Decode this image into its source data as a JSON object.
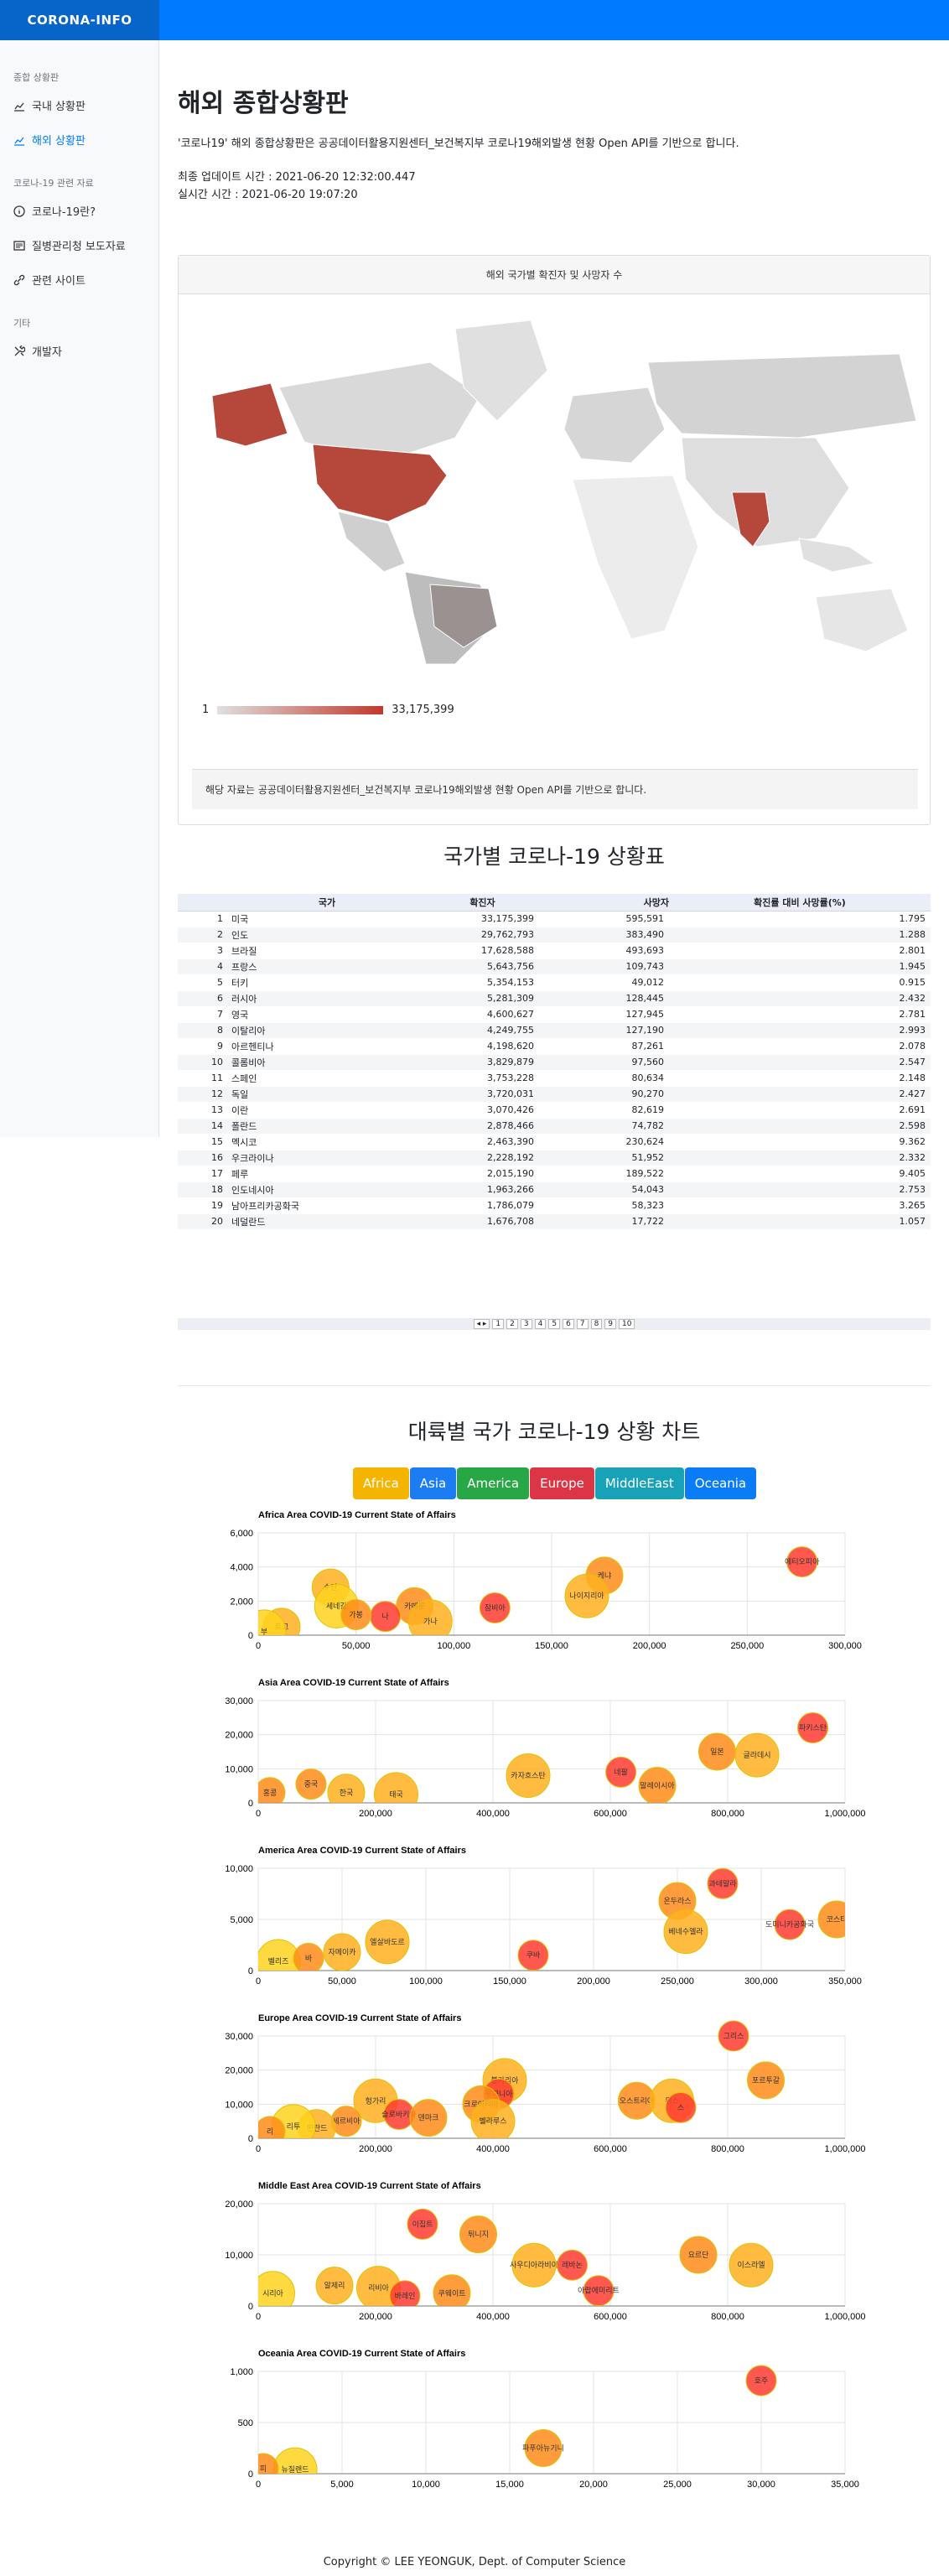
{
  "brand": "CORONA-INFO",
  "sidebar": {
    "sections": [
      {
        "heading": "종합 상황판",
        "items": [
          {
            "label": "국내 상황판",
            "icon": "chart-line-icon",
            "active": false
          },
          {
            "label": "해외 상황판",
            "icon": "chart-line-icon",
            "active": true
          }
        ]
      },
      {
        "heading": "코로나-19 관련 자료",
        "items": [
          {
            "label": "코로나-19란?",
            "icon": "info-circle-icon",
            "active": false
          },
          {
            "label": "질병관리청 보도자료",
            "icon": "newspaper-icon",
            "active": false
          },
          {
            "label": "관련 사이트",
            "icon": "link-icon",
            "active": false
          }
        ]
      },
      {
        "heading": "기타",
        "items": [
          {
            "label": "개발자",
            "icon": "tools-icon",
            "active": false
          }
        ]
      }
    ]
  },
  "page": {
    "title": "해외 종합상황판",
    "description": "'코로나19' 해외 종합상황판은 공공데이터활용지원센터_보건복지부 코로나19해외발생 현황 Open API를 기반으로 합니다.",
    "updated": "최종 업데이트 시간 : 2021-06-20 12:32:00.447",
    "realtime": "실시간 시간 : 2021-06-20 19:07:20"
  },
  "map": {
    "header": "해외 국가별 확진자 및 사망자 수",
    "legend_min": "1",
    "legend_max": "33,175,399",
    "footer": "해당 자료는 공공데이터활용지원센터_보건복지부 코로나19해외발생 현황 Open API를 기반으로 합니다."
  },
  "table": {
    "title": "국가별 코로나-19 상황표",
    "headers": [
      "",
      "국가",
      "확진자",
      "사망자",
      "확진률 대비 사망률(%)"
    ],
    "rows": [
      [
        "1",
        "미국",
        "33,175,399",
        "595,591",
        "1.795"
      ],
      [
        "2",
        "인도",
        "29,762,793",
        "383,490",
        "1.288"
      ],
      [
        "3",
        "브라질",
        "17,628,588",
        "493,693",
        "2.801"
      ],
      [
        "4",
        "프랑스",
        "5,643,756",
        "109,743",
        "1.945"
      ],
      [
        "5",
        "터키",
        "5,354,153",
        "49,012",
        "0.915"
      ],
      [
        "6",
        "러시아",
        "5,281,309",
        "128,445",
        "2.432"
      ],
      [
        "7",
        "영국",
        "4,600,627",
        "127,945",
        "2.781"
      ],
      [
        "8",
        "이탈리아",
        "4,249,755",
        "127,190",
        "2.993"
      ],
      [
        "9",
        "아르헨티나",
        "4,198,620",
        "87,261",
        "2.078"
      ],
      [
        "10",
        "콜롬비아",
        "3,829,879",
        "97,560",
        "2.547"
      ],
      [
        "11",
        "스페인",
        "3,753,228",
        "80,634",
        "2.148"
      ],
      [
        "12",
        "독일",
        "3,720,031",
        "90,270",
        "2.427"
      ],
      [
        "13",
        "이란",
        "3,070,426",
        "82,619",
        "2.691"
      ],
      [
        "14",
        "폴란드",
        "2,878,466",
        "74,782",
        "2.598"
      ],
      [
        "15",
        "멕시코",
        "2,463,390",
        "230,624",
        "9.362"
      ],
      [
        "16",
        "우크라이나",
        "2,228,192",
        "51,952",
        "2.332"
      ],
      [
        "17",
        "페루",
        "2,015,190",
        "189,522",
        "9.405"
      ],
      [
        "18",
        "인도네시아",
        "1,963,266",
        "54,043",
        "2.753"
      ],
      [
        "19",
        "남아프리카공화국",
        "1,786,079",
        "58,323",
        "3.265"
      ],
      [
        "20",
        "네덜란드",
        "1,676,708",
        "17,722",
        "1.057"
      ]
    ],
    "pages": [
      "1",
      "2",
      "3",
      "4",
      "5",
      "6",
      "7",
      "8",
      "9",
      "10"
    ]
  },
  "continent": {
    "title": "대륙별 국가 코로나-19 상황 차트",
    "tabs": [
      {
        "label": "Africa",
        "color": "#f5b400"
      },
      {
        "label": "Asia",
        "color": "#1c7cf2"
      },
      {
        "label": "America",
        "color": "#27a745"
      },
      {
        "label": "Europe",
        "color": "#dc3545"
      },
      {
        "label": "MiddleEast",
        "color": "#17a2b8"
      },
      {
        "label": "Oceania",
        "color": "#0a7cf5"
      }
    ]
  },
  "chart_data": [
    {
      "type": "scatter",
      "title": "Africa Area COVID-19 Current State of Affairs",
      "xlim": [
        0,
        300000
      ],
      "ylim": [
        0,
        6000
      ],
      "xticks": [
        "0",
        "50,000",
        "100,000",
        "150,000",
        "200,000",
        "250,000",
        "300,000"
      ],
      "yticks": [
        "0",
        "2,000",
        "4,000",
        "6,000"
      ],
      "points": [
        [
          278000,
          4300,
          "에티오피아"
        ],
        [
          177000,
          3500,
          "케냐"
        ],
        [
          168000,
          2300,
          "나이지리아"
        ],
        [
          121000,
          1600,
          "잠비아"
        ],
        [
          80000,
          1700,
          "카메룬"
        ],
        [
          88000,
          800,
          "가나"
        ],
        [
          65000,
          1100,
          "나"
        ],
        [
          37000,
          2800,
          "수단"
        ],
        [
          40000,
          1700,
          "세네갈"
        ],
        [
          50000,
          1200,
          "가봉"
        ],
        [
          12000,
          500,
          "토고"
        ],
        [
          3000,
          200,
          "부"
        ]
      ]
    },
    {
      "type": "scatter",
      "title": "Asia Area COVID-19 Current State of Affairs",
      "xlim": [
        0,
        1000000
      ],
      "ylim": [
        0,
        30000
      ],
      "xticks": [
        "0",
        "200,000",
        "400,000",
        "600,000",
        "800,000",
        "1,000,000"
      ],
      "yticks": [
        "0",
        "10,000",
        "20,000",
        "30,000"
      ],
      "points": [
        [
          945000,
          22000,
          "파키스탄"
        ],
        [
          782000,
          15000,
          "일본"
        ],
        [
          850000,
          14000,
          "글라데시"
        ],
        [
          618000,
          9000,
          "네팔"
        ],
        [
          680000,
          5000,
          "말레이시아"
        ],
        [
          460000,
          8000,
          "카자흐스탄"
        ],
        [
          90000,
          5500,
          "중국"
        ],
        [
          150000,
          3000,
          "한국"
        ],
        [
          235000,
          2500,
          "태국"
        ],
        [
          20000,
          3000,
          "홍콩"
        ]
      ]
    },
    {
      "type": "scatter",
      "title": "America Area COVID-19 Current State of Affairs",
      "xlim": [
        0,
        350000
      ],
      "ylim": [
        0,
        10000
      ],
      "xticks": [
        "0",
        "50,000",
        "100,000",
        "150,000",
        "200,000",
        "250,000",
        "300,000",
        "350,000"
      ],
      "yticks": [
        "0",
        "5,000",
        "10,000"
      ],
      "points": [
        [
          277000,
          8500,
          "과테말라"
        ],
        [
          250000,
          6800,
          "온두라스"
        ],
        [
          255000,
          3800,
          "베네수엘라"
        ],
        [
          317000,
          4500,
          "도미니카공화국"
        ],
        [
          345000,
          5000,
          "코스타"
        ],
        [
          77000,
          2800,
          "엘살바도르"
        ],
        [
          164000,
          1500,
          "쿠바"
        ],
        [
          50000,
          1800,
          "자메이카"
        ],
        [
          12000,
          900,
          "벨리즈"
        ],
        [
          30000,
          1200,
          "바"
        ]
      ]
    },
    {
      "type": "scatter",
      "title": "Europe Area COVID-19 Current State of Affairs",
      "xlim": [
        0,
        1000000
      ],
      "ylim": [
        0,
        30000
      ],
      "xticks": [
        "0",
        "200,000",
        "400,000",
        "600,000",
        "800,000",
        "1,000,000"
      ],
      "yticks": [
        "0",
        "10,000",
        "20,000",
        "30,000"
      ],
      "points": [
        [
          810000,
          30000,
          "그리스"
        ],
        [
          865000,
          17000,
          "포르투갈"
        ],
        [
          420000,
          17000,
          "불가리아"
        ],
        [
          410000,
          13000,
          "루마니아"
        ],
        [
          645000,
          11000,
          "오스트리아"
        ],
        [
          705000,
          11000,
          "위스"
        ],
        [
          720000,
          9000,
          "스"
        ],
        [
          380000,
          10000,
          "크로아티아"
        ],
        [
          200000,
          11000,
          "헝가리"
        ],
        [
          240000,
          7000,
          "슬로바키아"
        ],
        [
          290000,
          6000,
          "덴마크"
        ],
        [
          400000,
          5000,
          "벨라루스"
        ],
        [
          150000,
          5000,
          "세르비아"
        ],
        [
          100000,
          3000,
          "핀란드"
        ],
        [
          60000,
          3500,
          "리투"
        ],
        [
          20000,
          2000,
          "리"
        ]
      ]
    },
    {
      "type": "scatter",
      "title": "Middle East Area COVID-19 Current State of Affairs",
      "xlim": [
        0,
        1000000
      ],
      "ylim": [
        0,
        20000
      ],
      "xticks": [
        "0",
        "200,000",
        "400,000",
        "600,000",
        "800,000",
        "1,000,000"
      ],
      "yticks": [
        "0",
        "10,000",
        "20,000"
      ],
      "points": [
        [
          280000,
          16000,
          "이집트"
        ],
        [
          375000,
          14000,
          "튀니지"
        ],
        [
          470000,
          8000,
          "사우디아라비아"
        ],
        [
          535000,
          8000,
          "레바논"
        ],
        [
          750000,
          10000,
          "요르단"
        ],
        [
          840000,
          8000,
          "이스라엘"
        ],
        [
          580000,
          3000,
          "아랍에미리트"
        ],
        [
          130000,
          4000,
          "알제리"
        ],
        [
          205000,
          3500,
          "리비아"
        ],
        [
          250000,
          2000,
          "바레인"
        ],
        [
          330000,
          2500,
          "쿠웨이트"
        ],
        [
          25000,
          2500,
          "시리아"
        ]
      ]
    },
    {
      "type": "scatter",
      "title": "Oceania Area COVID-19 Current State of Affairs",
      "xlim": [
        0,
        35000
      ],
      "ylim": [
        0,
        1000
      ],
      "xticks": [
        "0",
        "5,000",
        "10,000",
        "15,000",
        "20,000",
        "25,000",
        "30,000",
        "35,000"
      ],
      "yticks": [
        "0",
        "500",
        "1,000"
      ],
      "points": [
        [
          30000,
          910,
          "호주"
        ],
        [
          17000,
          250,
          "파푸아뉴기니"
        ],
        [
          2200,
          40,
          "뉴질랜드"
        ],
        [
          300,
          50,
          "피"
        ]
      ]
    }
  ],
  "footer": "Copyright © LEE YEONGUK, Dept. of Computer Science"
}
